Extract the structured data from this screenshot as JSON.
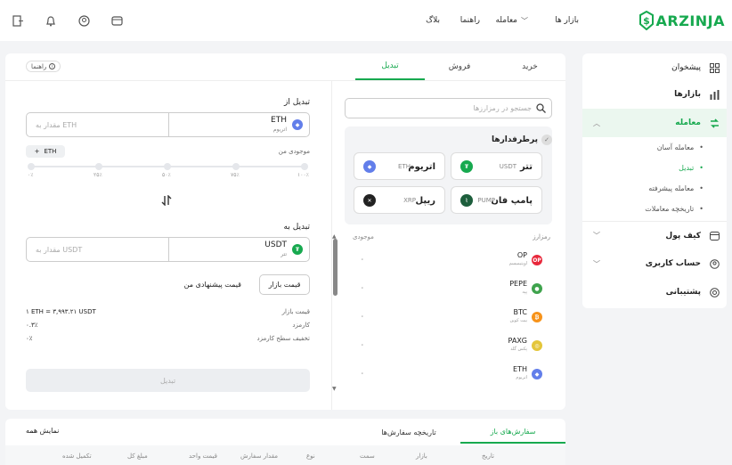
{
  "brand": {
    "name": "ARZINJA"
  },
  "nav": {
    "markets": "بازار ها",
    "trade": "معامله",
    "guide": "راهنما",
    "blog": "بلاگ"
  },
  "sidebar": {
    "dashboard": "پیشخوان",
    "markets": "بازارها",
    "trade": "معامله",
    "easy_trade": "معامله آسان",
    "convert": "تبدیل",
    "advanced_trade": "معامله پیشرفته",
    "trade_history": "تاریخچه معاملات",
    "wallet": "کیف پول",
    "account": "حساب کاربری",
    "support": "پشتیبانی"
  },
  "tabs": {
    "buy": "خرید",
    "sell": "فروش",
    "convert": "تبدیل",
    "guide": "راهنما"
  },
  "search": {
    "placeholder": "جستجو در رمزارزها"
  },
  "popular": {
    "title": "پرطرفدارها",
    "items": [
      {
        "name": "تتر",
        "symbol": "USDT"
      },
      {
        "name": "اتریوم",
        "symbol": "ETH"
      },
      {
        "name": "پامپ فان",
        "symbol": "PUMP"
      },
      {
        "name": "ریپل",
        "symbol": "XRP"
      }
    ]
  },
  "list": {
    "col_currency": "رمزارز",
    "col_balance": "موجودی",
    "rows": [
      {
        "symbol": "OP",
        "name": "اوپتیمیسم",
        "balance": "۰"
      },
      {
        "symbol": "PEPE",
        "name": "پپه",
        "balance": "۰"
      },
      {
        "symbol": "BTC",
        "name": "بیت کوین",
        "balance": "۰"
      },
      {
        "symbol": "PAXG",
        "name": "پکس گلد",
        "balance": "۰"
      },
      {
        "symbol": "ETH",
        "name": "اتریوم",
        "balance": "۰"
      }
    ]
  },
  "convert": {
    "from_label": "تبدیل از",
    "from_symbol": "ETH",
    "from_name": "اتریوم",
    "amount_placeholder": "مقدار به ETH",
    "balance_label": "موجودی من",
    "balance_value": "ETH",
    "slider": [
      "۰٪",
      "۲۵٪",
      "۵۰٪",
      "۷۵٪",
      "۱۰۰٪"
    ],
    "to_label": "تبدیل به",
    "to_symbol": "USDT",
    "to_name": "تتر",
    "to_placeholder": "مقدار به USDT",
    "market_price_btn": "قیمت بازار",
    "suggested_price": "قیمت پیشنهادی من",
    "info": [
      {
        "label": "قیمت بازار",
        "value": "۱ ETH = ۳,۹۹۳.۲۱ USDT"
      },
      {
        "label": "کارمزد",
        "value": "۰.۳٪"
      },
      {
        "label": "تخفیف سطح کارمزد",
        "value": "۰٪"
      }
    ],
    "submit": "تبدیل"
  },
  "orders": {
    "open_tab": "سفارش‌های باز",
    "history_tab": "تاریخچه سفارش‌ها",
    "show_all": "نمایش همه",
    "columns": [
      "تاریخ",
      "بازار",
      "سمت",
      "نوع",
      "مقدار سفارش",
      "قیمت واحد",
      "مبلغ کل",
      "تکمیل شده"
    ]
  },
  "colors": {
    "accent": "#17a94f",
    "brand": "#17a94f"
  }
}
